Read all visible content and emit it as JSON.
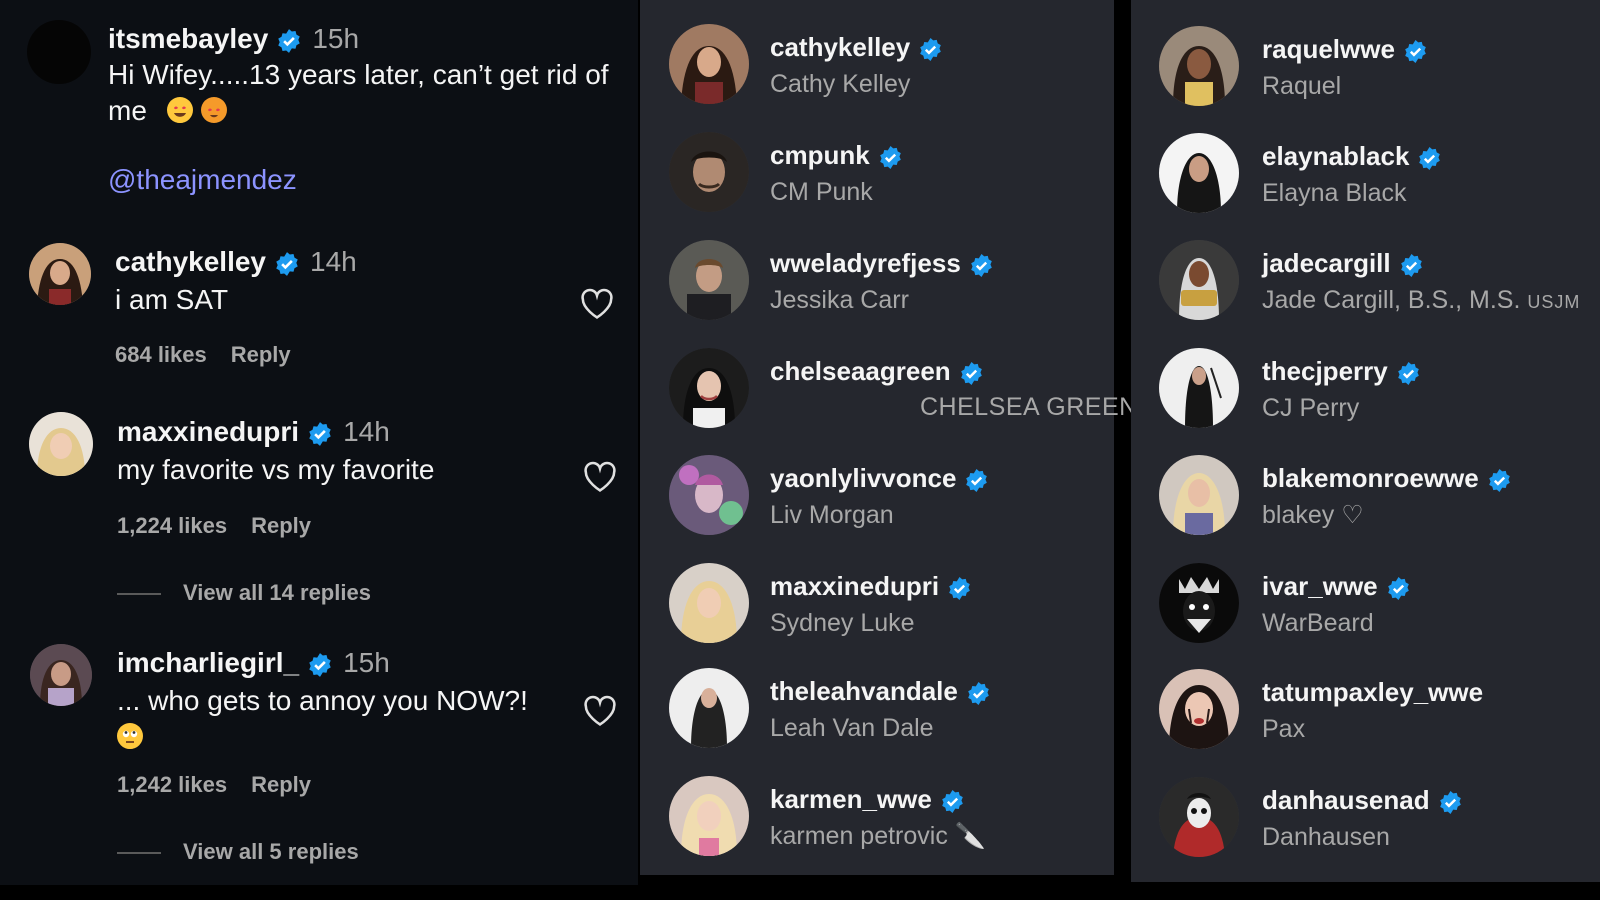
{
  "colors": {
    "verified": "#1d9bf0",
    "link": "#8c93ff",
    "muted": "#a8a8a8",
    "panel": "#25272e",
    "comments_bg": "#0c0f14"
  },
  "post": {
    "username": "itsmebayley",
    "time": "15h",
    "text_line1": "Hi Wifey.....13 years later, can’t get rid of",
    "text_line2": "me",
    "mention": "@theajmendez",
    "emojis": [
      "smiling-face-with-heart-eyes",
      "heart-eyes-cat"
    ]
  },
  "comments": [
    {
      "username": "cathykelley",
      "time": "14h",
      "text": "i am SAT",
      "likes": "684 likes",
      "reply": "Reply"
    },
    {
      "username": "maxxinedupri",
      "time": "14h",
      "text": "my favorite vs my favorite",
      "likes": "1,224 likes",
      "reply": "Reply",
      "view_replies": "View all 14 replies"
    },
    {
      "username": "imcharliegirl_",
      "time": "15h",
      "text": "... who gets to annoy you NOW?!",
      "likes": "1,242 likes",
      "reply": "Reply",
      "view_replies": "View all 5 replies",
      "emoji": "face-with-rolling-eyes"
    }
  ],
  "list_mid": [
    {
      "username": "cathykelley",
      "name": "Cathy Kelley"
    },
    {
      "username": "cmpunk",
      "name": "CM Punk"
    },
    {
      "username": "wweladyrefjess",
      "name": "Jessika Carr"
    },
    {
      "username": "chelseaagreen",
      "name": "CHELSEA GREEN"
    },
    {
      "username": "yaonlylivvonce",
      "name": "Liv Morgan"
    },
    {
      "username": "maxxinedupri",
      "name": "Sydney Luke"
    },
    {
      "username": "theleahvandale",
      "name": "Leah Van Dale"
    },
    {
      "username": "karmen_wwe",
      "name": "karmen petrovic 🔪"
    }
  ],
  "list_right": [
    {
      "username": "raquelwwe",
      "name": "Raquel"
    },
    {
      "username": "elaynablack",
      "name": "Elayna Black"
    },
    {
      "username": "jadecargill",
      "name": "Jade Cargill, B.S., M.S.",
      "suffix": "USJM"
    },
    {
      "username": "thecjperry",
      "name": "CJ Perry"
    },
    {
      "username": "blakemonroewwe",
      "name": "blakey ♡"
    },
    {
      "username": "ivar_wwe",
      "name": "WarBeard"
    },
    {
      "username": "tatumpaxley_wwe",
      "name": "Pax"
    },
    {
      "username": "danhausenad",
      "name": "Danhausen"
    }
  ]
}
